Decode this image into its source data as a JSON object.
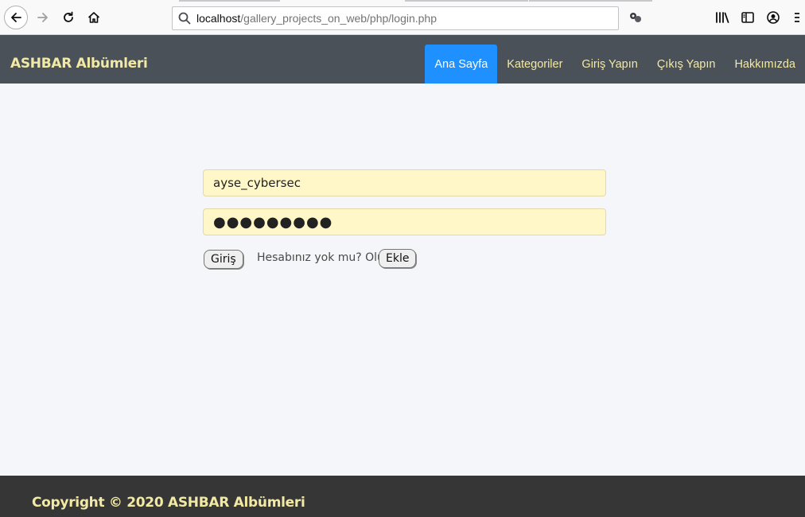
{
  "browser": {
    "url_host": "localhost",
    "url_path": "/gallery_projects_on_web/php/login.php",
    "icons": [
      "back-arrow-icon",
      "forward-arrow-icon",
      "reload-icon",
      "home-icon",
      "search-icon",
      "extension-icon",
      "library-icon",
      "sidebar-icon",
      "account-icon",
      "menu-icon"
    ]
  },
  "navbar": {
    "brand": "ASHBAR Albümleri",
    "items": [
      {
        "label": "Ana Sayfa",
        "active": true
      },
      {
        "label": "Kategoriler"
      },
      {
        "label": "Giriş Yapın"
      },
      {
        "label": "Çıkış Yapın"
      },
      {
        "label": "Hakkımızda"
      }
    ]
  },
  "login": {
    "username_value": "ayse_cybersec",
    "password_value": "●●●●●●●●●",
    "login_button": "Giriş",
    "signup_prompt": "Hesabınız yok mu? Oluşt",
    "add_button": "Ekle"
  },
  "footer": {
    "text": "Copyright © 2020 ASHBAR Albümleri"
  },
  "colors": {
    "navbar_bg": "#4b5158",
    "accent_text": "#f2e9a4",
    "active_nav": "#1e90ff",
    "field_bg": "#fff7c8",
    "footer_bg": "#363636"
  }
}
